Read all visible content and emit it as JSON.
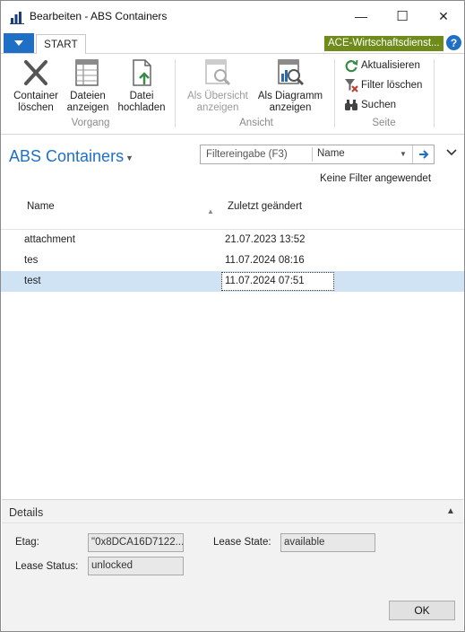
{
  "window": {
    "title": "Bearbeiten - ABS Containers",
    "minimize_glyph": "—",
    "maximize_glyph": "☐",
    "close_glyph": "✕"
  },
  "ribbon": {
    "tab_start": "START",
    "company": "ACE-Wirtschaftsdienst...",
    "help_glyph": "?",
    "buttons": {
      "container_delete": "Container löschen",
      "show_files": "Dateien anzeigen",
      "upload_file": "Datei hochladen",
      "as_overview": "Als Übersicht anzeigen",
      "as_chart": "Als Diagramm anzeigen",
      "refresh": "Aktualisieren",
      "clear_filter": "Filter löschen",
      "search": "Suchen"
    },
    "groups": {
      "process": "Vorgang",
      "view": "Ansicht",
      "page": "Seite"
    },
    "colors": {
      "accent": "#1f6fc5",
      "company_badge": "#6f8c1a"
    }
  },
  "page": {
    "title": "ABS Containers",
    "filter": {
      "placeholder": "Filtereingabe (F3)",
      "field": "Name"
    },
    "no_filter_text": "Keine Filter angewendet"
  },
  "table": {
    "columns": [
      "Name",
      "Zuletzt geändert"
    ],
    "rows": [
      {
        "name": "attachment",
        "modified": "21.07.2023 13:52"
      },
      {
        "name": "tes",
        "modified": "11.07.2024 08:16"
      },
      {
        "name": "test",
        "modified": "11.07.2024 07:51"
      }
    ],
    "selected_row": "test"
  },
  "details": {
    "title": "Details",
    "etag_label": "Etag:",
    "etag_value": "\"0x8DCA16D7122...",
    "lease_state_label": "Lease State:",
    "lease_state_value": "available",
    "lease_status_label": "Lease Status:",
    "lease_status_value": "unlocked"
  },
  "footer": {
    "ok_label": "OK"
  }
}
